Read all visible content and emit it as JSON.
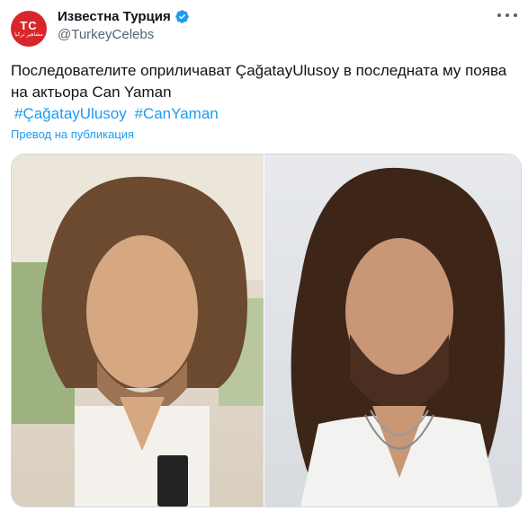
{
  "author": {
    "display_name": "Известна Турция",
    "handle": "@TurkeyCelebs",
    "avatar_initials": "TC",
    "avatar_subtext": "مشاهير تركيا",
    "avatar_color": "#d8262b",
    "verified_icon": "verified-badge-icon"
  },
  "tweet": {
    "text": "Последователите оприличават ÇağatayUlusoy в последната му поява на актьора Can Yaman",
    "hashtags": [
      "#ÇağatayUlusoy",
      "#CanYaman"
    ],
    "translate_label": "Превод на публикация"
  },
  "colors": {
    "link": "#1d9bf0",
    "text": "#0f1419",
    "secondary": "#536471",
    "border": "#cfd9de"
  },
  "media": {
    "count": 2
  }
}
